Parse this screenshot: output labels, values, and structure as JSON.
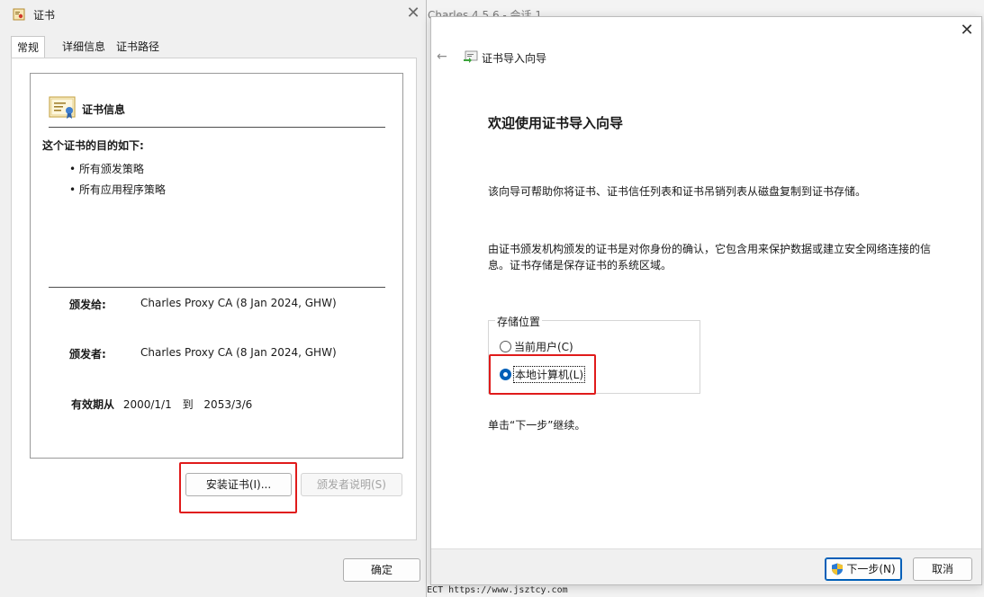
{
  "background_window": {
    "title": "Charles 4.5.6 - 会话 1",
    "status_text": "CONNECT https://www.jsztcy.com"
  },
  "cert_dialog": {
    "title": "证书",
    "title_icon": "certificate-icon",
    "close_glyph": "✕",
    "tabs": [
      {
        "label": "常规",
        "active": true
      },
      {
        "label": "详细信息",
        "active": false
      },
      {
        "label": "证书路径",
        "active": false
      }
    ],
    "info": {
      "heading": "证书信息",
      "heading_icon": "certificate-icon",
      "purpose_title": "这个证书的目的如下:",
      "purposes": [
        "• 所有颁发策略",
        "• 所有应用程序策略"
      ],
      "issued_to_label": "颁发给:",
      "issued_to_value": "Charles Proxy CA (8 Jan 2024, GHW)",
      "issued_by_label": "颁发者:",
      "issued_by_value": "Charles Proxy CA (8 Jan 2024, GHW)",
      "validity_label": "有效期从",
      "valid_from": "2000/1/1",
      "valid_to_label": "到",
      "valid_to": "2053/3/6"
    },
    "install_button": "安装证书(I)...",
    "issuer_statement_button": "颁发者说明(S)",
    "ok_button": "确定"
  },
  "wizard": {
    "close_glyph": "✕",
    "back_glyph": "←",
    "title": "证书导入向导",
    "title_icon": "certificate-import-icon",
    "heading": "欢迎使用证书导入向导",
    "description1": "该向导可帮助你将证书、证书信任列表和证书吊销列表从磁盘复制到证书存储。",
    "description2": "由证书颁发机构颁发的证书是对你身份的确认，它包含用来保护数据或建立安全网络连接的信息。证书存储是保存证书的系统区域。",
    "store_location": {
      "legend": "存储位置",
      "options": [
        {
          "label": "当前用户(C)",
          "checked": false
        },
        {
          "label": "本地计算机(L)",
          "checked": true
        }
      ]
    },
    "continue_text": "单击“下一步”继续。",
    "next_button": "下一步(N)",
    "cancel_button": "取消",
    "accent_color": "#005fb8",
    "highlight_color": "#e01b1b"
  }
}
